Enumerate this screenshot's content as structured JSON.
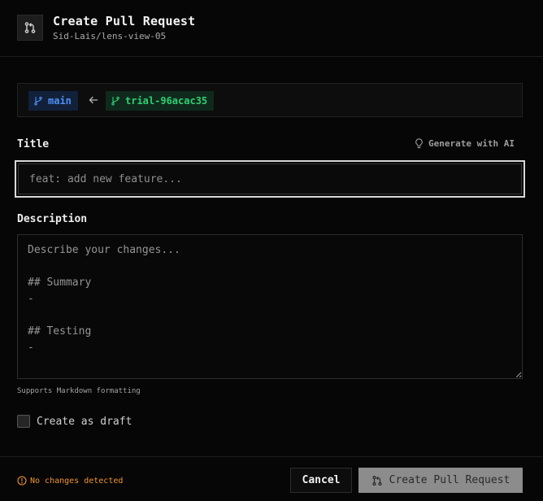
{
  "header": {
    "title": "Create Pull Request",
    "repo": "Sid-Lais/lens-view-05",
    "icon": "pull-request-icon"
  },
  "branches": {
    "base": "main",
    "head": "trial-96acac35",
    "base_color": "#4f8ff7",
    "head_color": "#2fcf73"
  },
  "title_field": {
    "label": "Title",
    "placeholder": "feat: add new feature...",
    "value": "",
    "generate_label": "Generate with AI"
  },
  "description_field": {
    "label": "Description",
    "placeholder": "Describe your changes...\n\n## Summary\n-\n\n## Testing\n-",
    "hint": "Supports Markdown formatting"
  },
  "draft": {
    "label": "Create as draft",
    "checked": false
  },
  "footer": {
    "status": "No changes detected",
    "status_color": "#f0952e",
    "cancel_label": "Cancel",
    "create_label": "Create Pull Request"
  }
}
